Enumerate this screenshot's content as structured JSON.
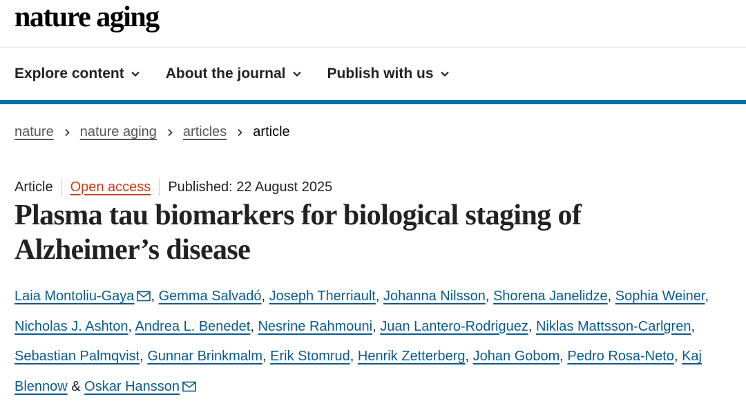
{
  "site": {
    "logo": "nature aging"
  },
  "nav": {
    "items": [
      {
        "label": "Explore content"
      },
      {
        "label": "About the journal"
      },
      {
        "label": "Publish with us"
      }
    ]
  },
  "breadcrumb": {
    "items": [
      "nature",
      "nature aging",
      "articles"
    ],
    "current": "article"
  },
  "article": {
    "type": "Article",
    "access": "Open access",
    "published": "Published: 22 August 2025",
    "title": "Plasma tau biomarkers for biological staging of Alzheimer’s disease",
    "authors": [
      {
        "name": "Laia Montoliu-Gaya",
        "sep": ", "
      },
      {
        "name": "Gemma Salvadó",
        "sep": ", "
      },
      {
        "name": "Joseph Therriault",
        "sep": ", "
      },
      {
        "name": "Johanna Nilsson",
        "sep": ", "
      },
      {
        "name": "Shorena Janelidze",
        "sep": ", "
      },
      {
        "name": "Sophia Weiner",
        "sep": ", "
      },
      {
        "name": "Nicholas J. Ashton",
        "sep": ", "
      },
      {
        "name": "Andrea L. Benedet",
        "sep": ", "
      },
      {
        "name": "Nesrine Rahmouni",
        "sep": ", "
      },
      {
        "name": "Juan Lantero-Rodriguez",
        "sep": ", "
      },
      {
        "name": "Niklas Mattsson-Carlgren",
        "sep": ", "
      },
      {
        "name": "Sebastian Palmqvist",
        "sep": ", "
      },
      {
        "name": "Gunnar Brinkmalm",
        "sep": ", "
      },
      {
        "name": "Erik Stomrud",
        "sep": ", "
      },
      {
        "name": "Henrik Zetterberg",
        "sep": ", "
      },
      {
        "name": "Johan Gobom",
        "sep": ", "
      },
      {
        "name": "Pedro Rosa-Neto",
        "sep": ", "
      },
      {
        "name": "Kaj Blennow",
        "sep": " & "
      },
      {
        "name": "Oskar Hansson",
        "sep": ""
      }
    ],
    "corresponding_icon": "envelope-icon"
  },
  "colors": {
    "accent_bar": "#0070a8",
    "author_link": "#0a5a8c",
    "open_access": "#c4401a"
  }
}
